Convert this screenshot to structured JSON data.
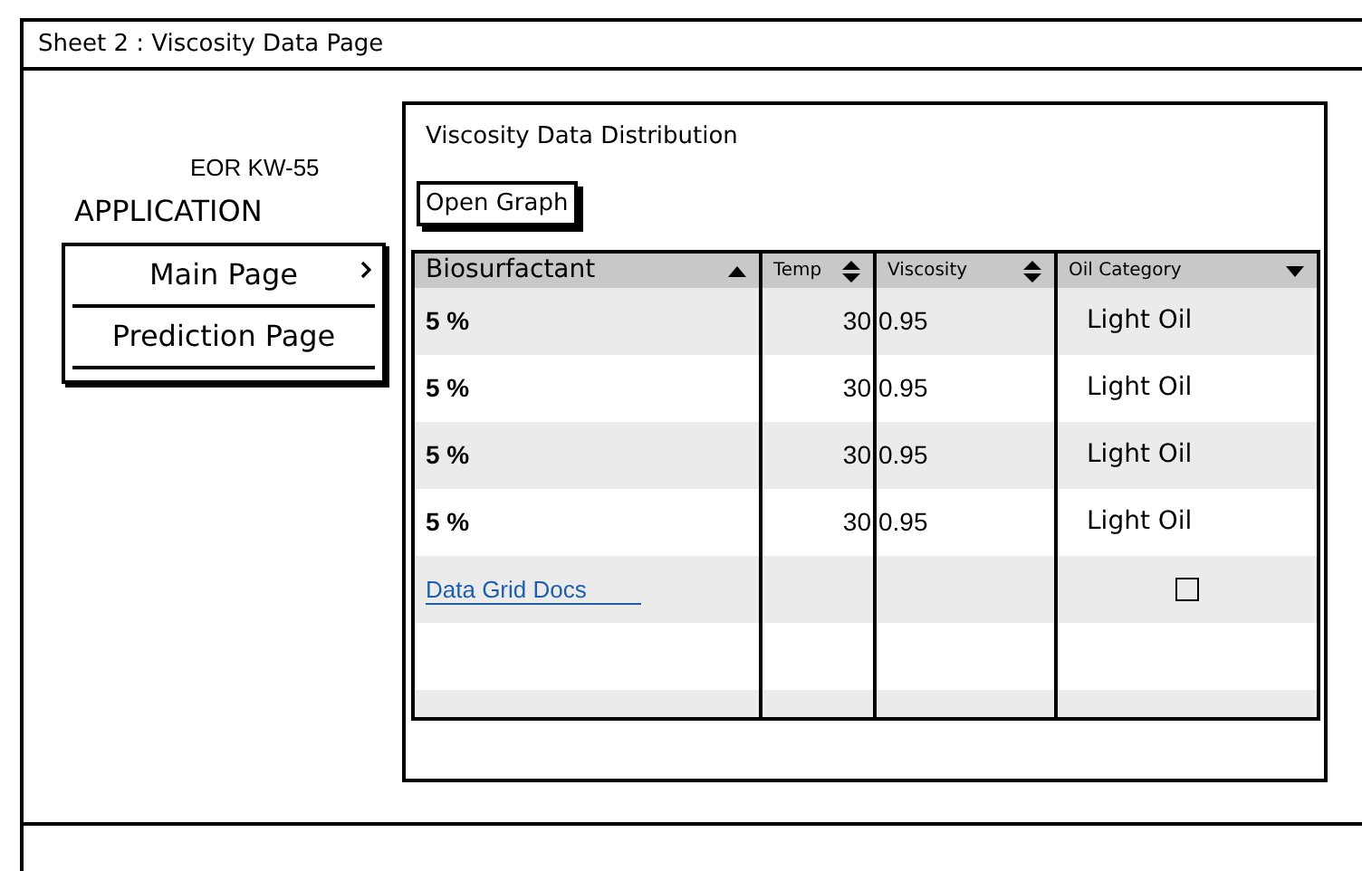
{
  "window": {
    "title": "Sheet 2 :  Viscosity Data Page"
  },
  "sidebar": {
    "subtitle": "EOR KW-55",
    "title": "APPLICATION",
    "items": [
      {
        "label": "Main Page",
        "submenu": true
      },
      {
        "label": "Prediction Page",
        "submenu": false
      }
    ]
  },
  "panel": {
    "title": "Viscosity Data Distribution",
    "button": "Open Graph",
    "table": {
      "columns": [
        {
          "label": "Biosurfactant",
          "kind": "ascending"
        },
        {
          "label": "Temp",
          "kind": "unsorted"
        },
        {
          "label": "Viscosity",
          "kind": "unsorted"
        },
        {
          "label": "Oil Category",
          "kind": "descending"
        }
      ],
      "rows": [
        {
          "kind": "data",
          "cells": [
            "5 %",
            "30",
            "0.95",
            "Light Oil"
          ]
        },
        {
          "kind": "data",
          "cells": [
            "5 %",
            "30",
            "0.95",
            "Light Oil"
          ]
        },
        {
          "kind": "data",
          "cells": [
            "5 %",
            "30",
            "0.95",
            "Light Oil"
          ]
        },
        {
          "kind": "data",
          "cells": [
            "5 %",
            "30",
            "0.95",
            "Light Oil"
          ]
        },
        {
          "kind": "link",
          "link": "Data Grid Docs",
          "checked": false
        },
        {
          "kind": "empty"
        },
        {
          "kind": "empty"
        }
      ]
    }
  }
}
